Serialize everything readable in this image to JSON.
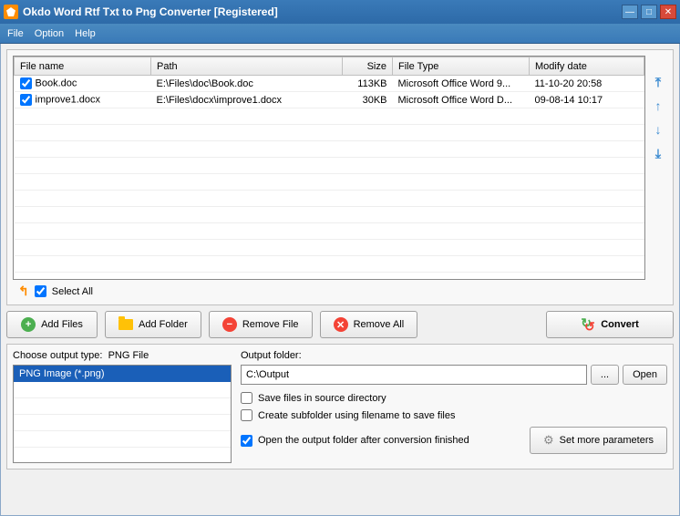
{
  "window": {
    "title": "Okdo Word Rtf Txt to Png Converter [Registered]"
  },
  "menu": {
    "file": "File",
    "option": "Option",
    "help": "Help"
  },
  "columns": {
    "name": "File name",
    "path": "Path",
    "size": "Size",
    "type": "File Type",
    "modify": "Modify date"
  },
  "files": [
    {
      "name": "Book.doc",
      "path": "E:\\Files\\doc\\Book.doc",
      "size": "113KB",
      "type": "Microsoft Office Word 9...",
      "modify": "11-10-20 20:58"
    },
    {
      "name": "improve1.docx",
      "path": "E:\\Files\\docx\\improve1.docx",
      "size": "30KB",
      "type": "Microsoft Office Word D...",
      "modify": "09-08-14 10:17"
    }
  ],
  "selectall": "Select All",
  "buttons": {
    "addfiles": "Add Files",
    "addfolder": "Add Folder",
    "removefile": "Remove File",
    "removeall": "Remove All",
    "convert": "Convert",
    "browse": "...",
    "open": "Open",
    "params": "Set more parameters"
  },
  "output": {
    "type_label": "Choose output type:",
    "type_current": "PNG File",
    "type_option": "PNG Image (*.png)",
    "folder_label": "Output folder:",
    "folder_value": "C:\\Output",
    "save_source": "Save files in source directory",
    "create_sub": "Create subfolder using filename to save files",
    "open_after": "Open the output folder after conversion finished"
  }
}
